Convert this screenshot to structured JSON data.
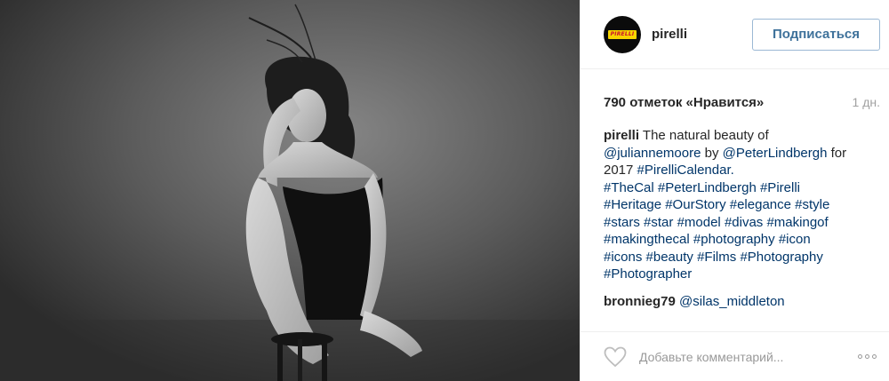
{
  "post": {
    "photo_alt": "Black and white portrait"
  },
  "header": {
    "avatar_logo_text": "PIRELLI",
    "username": "pirelli",
    "follow_label": "Подписаться"
  },
  "stats": {
    "likes": "790 отметок «Нравится»",
    "time": "1 дн."
  },
  "caption": {
    "username": "pirelli",
    "text_1": " The natural beauty of ",
    "mention_1": "@juliannemoore",
    "text_2": " by ",
    "mention_2": "@PeterLindbergh",
    "text_3": " for 2017 ",
    "hashtags": [
      "#PirelliCalendar.",
      "#TheCal",
      "#PeterLindbergh",
      "#Pirelli",
      "#Heritage",
      "#OurStory",
      "#elegance",
      "#style",
      "#stars",
      "#star",
      "#model",
      "#divas",
      "#makingof",
      "#makingthecal",
      "#photography",
      "#icon",
      "#icons",
      "#beauty",
      "#Films",
      "#Photography",
      "#Photographer"
    ]
  },
  "comment": {
    "username": "bronnieg79",
    "mention": "@silas_middleton"
  },
  "actions": {
    "like_icon": "heart-outline-icon",
    "comment_placeholder": "Добавьте комментарий...",
    "more_icon": "more-options-icon"
  },
  "colors": {
    "link": "#003569",
    "follow_text": "#3f729b",
    "brand_yellow": "#f6d400",
    "brand_red": "#c8102e"
  }
}
